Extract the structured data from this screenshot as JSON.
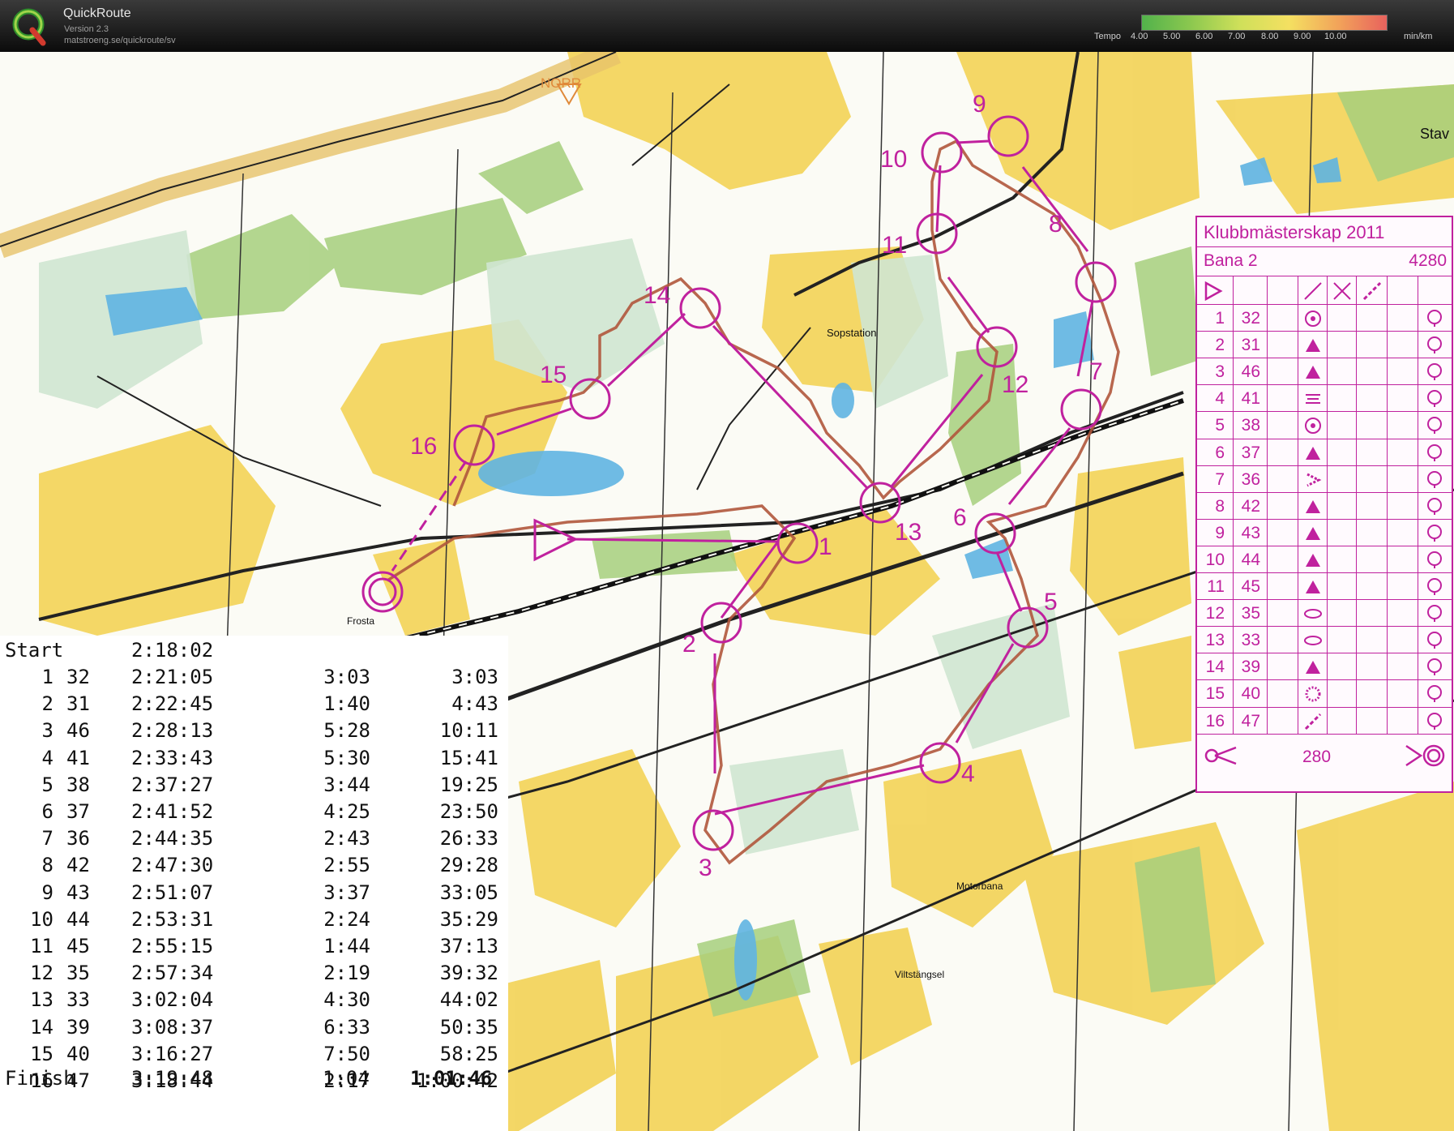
{
  "app": {
    "name": "QuickRoute",
    "version": "Version 2.3",
    "url": "matstroeng.se/quickroute/sv"
  },
  "tempo_legend": {
    "label": "Tempo",
    "ticks": [
      "4.00",
      "5.00",
      "6.00",
      "7.00",
      "8.00",
      "9.00",
      "10.00"
    ],
    "unit": "min/km",
    "colors": [
      "#52b24b",
      "#8cc84f",
      "#cfe05a",
      "#f4e061",
      "#f2a45a",
      "#e8625d"
    ]
  },
  "map": {
    "north_label": "NORR",
    "place_labels": [
      "Sopstation",
      "Motorbana",
      "Viltstängsel",
      "Frosta",
      "Stav"
    ],
    "control_numbers": [
      "1",
      "2",
      "3",
      "4",
      "5",
      "6",
      "7",
      "8",
      "9",
      "10",
      "11",
      "12",
      "13",
      "14",
      "15",
      "16"
    ],
    "colors": {
      "course": "#c0219e",
      "route": "#b0563c",
      "forest_open": "#f2d04c",
      "green": "#a6cf7d",
      "water": "#5fb4e2"
    }
  },
  "splits": {
    "start_label": "Start",
    "start_time": "2:18:02",
    "rows": [
      {
        "n": "1",
        "code": "32",
        "clock": "2:21:05",
        "leg": "3:03",
        "total": "3:03"
      },
      {
        "n": "2",
        "code": "31",
        "clock": "2:22:45",
        "leg": "1:40",
        "total": "4:43"
      },
      {
        "n": "3",
        "code": "46",
        "clock": "2:28:13",
        "leg": "5:28",
        "total": "10:11"
      },
      {
        "n": "4",
        "code": "41",
        "clock": "2:33:43",
        "leg": "5:30",
        "total": "15:41"
      },
      {
        "n": "5",
        "code": "38",
        "clock": "2:37:27",
        "leg": "3:44",
        "total": "19:25"
      },
      {
        "n": "6",
        "code": "37",
        "clock": "2:41:52",
        "leg": "4:25",
        "total": "23:50"
      },
      {
        "n": "7",
        "code": "36",
        "clock": "2:44:35",
        "leg": "2:43",
        "total": "26:33"
      },
      {
        "n": "8",
        "code": "42",
        "clock": "2:47:30",
        "leg": "2:55",
        "total": "29:28"
      },
      {
        "n": "9",
        "code": "43",
        "clock": "2:51:07",
        "leg": "3:37",
        "total": "33:05"
      },
      {
        "n": "10",
        "code": "44",
        "clock": "2:53:31",
        "leg": "2:24",
        "total": "35:29"
      },
      {
        "n": "11",
        "code": "45",
        "clock": "2:55:15",
        "leg": "1:44",
        "total": "37:13"
      },
      {
        "n": "12",
        "code": "35",
        "clock": "2:57:34",
        "leg": "2:19",
        "total": "39:32"
      },
      {
        "n": "13",
        "code": "33",
        "clock": "3:02:04",
        "leg": "4:30",
        "total": "44:02"
      },
      {
        "n": "14",
        "code": "39",
        "clock": "3:08:37",
        "leg": "6:33",
        "total": "50:35"
      },
      {
        "n": "15",
        "code": "40",
        "clock": "3:16:27",
        "leg": "7:50",
        "total": "58:25"
      },
      {
        "n": "16",
        "code": "47",
        "clock": "3:18:44",
        "leg": "2:17",
        "total": "1:00:42"
      }
    ],
    "finish_label": "Finish",
    "finish_time": "3:19:48",
    "finish_leg": "1:04",
    "finish_total": "1:01:46"
  },
  "control_card": {
    "title": "Klubbmästerskap 2011",
    "course": "Bana 2",
    "length": "4280",
    "rows": [
      {
        "n": "1",
        "code": "32",
        "feature": "knoll"
      },
      {
        "n": "2",
        "code": "31",
        "feature": "boulder"
      },
      {
        "n": "3",
        "code": "46",
        "feature": "boulder"
      },
      {
        "n": "4",
        "code": "41",
        "feature": "depression"
      },
      {
        "n": "5",
        "code": "38",
        "feature": "knoll"
      },
      {
        "n": "6",
        "code": "37",
        "feature": "boulder"
      },
      {
        "n": "7",
        "code": "36",
        "feature": "re-entrant"
      },
      {
        "n": "8",
        "code": "42",
        "feature": "boulder"
      },
      {
        "n": "9",
        "code": "43",
        "feature": "boulder"
      },
      {
        "n": "10",
        "code": "44",
        "feature": "boulder"
      },
      {
        "n": "11",
        "code": "45",
        "feature": "boulder"
      },
      {
        "n": "12",
        "code": "35",
        "feature": "thicket"
      },
      {
        "n": "13",
        "code": "33",
        "feature": "thicket"
      },
      {
        "n": "14",
        "code": "39",
        "feature": "boulder"
      },
      {
        "n": "15",
        "code": "40",
        "feature": "pit"
      },
      {
        "n": "16",
        "code": "47",
        "feature": "path"
      }
    ],
    "finish_distance": "280"
  }
}
